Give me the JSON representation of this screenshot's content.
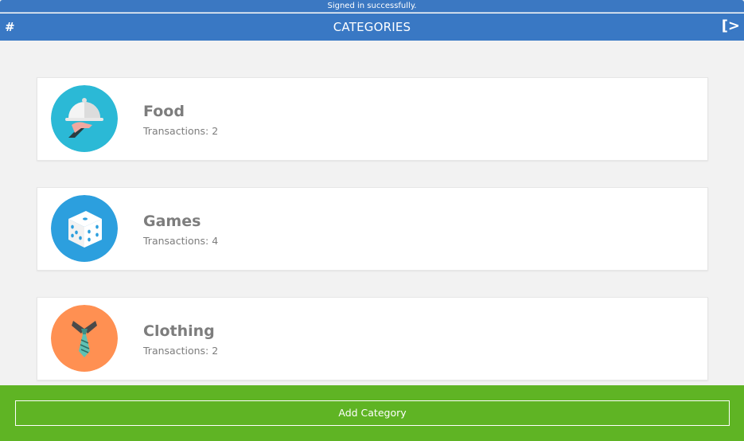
{
  "toast": {
    "message": "Signed in successfully."
  },
  "header": {
    "title": "CATEGORIES",
    "menu_glyph": "#",
    "signout_glyph": "[>"
  },
  "categories": [
    {
      "name": "Food",
      "transactions": "Transactions: 2",
      "icon": "food-cloche-icon",
      "color": "#2bb9d6"
    },
    {
      "name": "Games",
      "transactions": "Transactions: 4",
      "icon": "dice-icon",
      "color": "#2c9fde"
    },
    {
      "name": "Clothing",
      "transactions": "Transactions: 2",
      "icon": "necktie-icon",
      "color": "#ff9052"
    }
  ],
  "footer": {
    "add_label": "Add Category"
  },
  "colors": {
    "header": "#3978c4",
    "footer": "#5fb424",
    "background": "#f2f2f2"
  }
}
